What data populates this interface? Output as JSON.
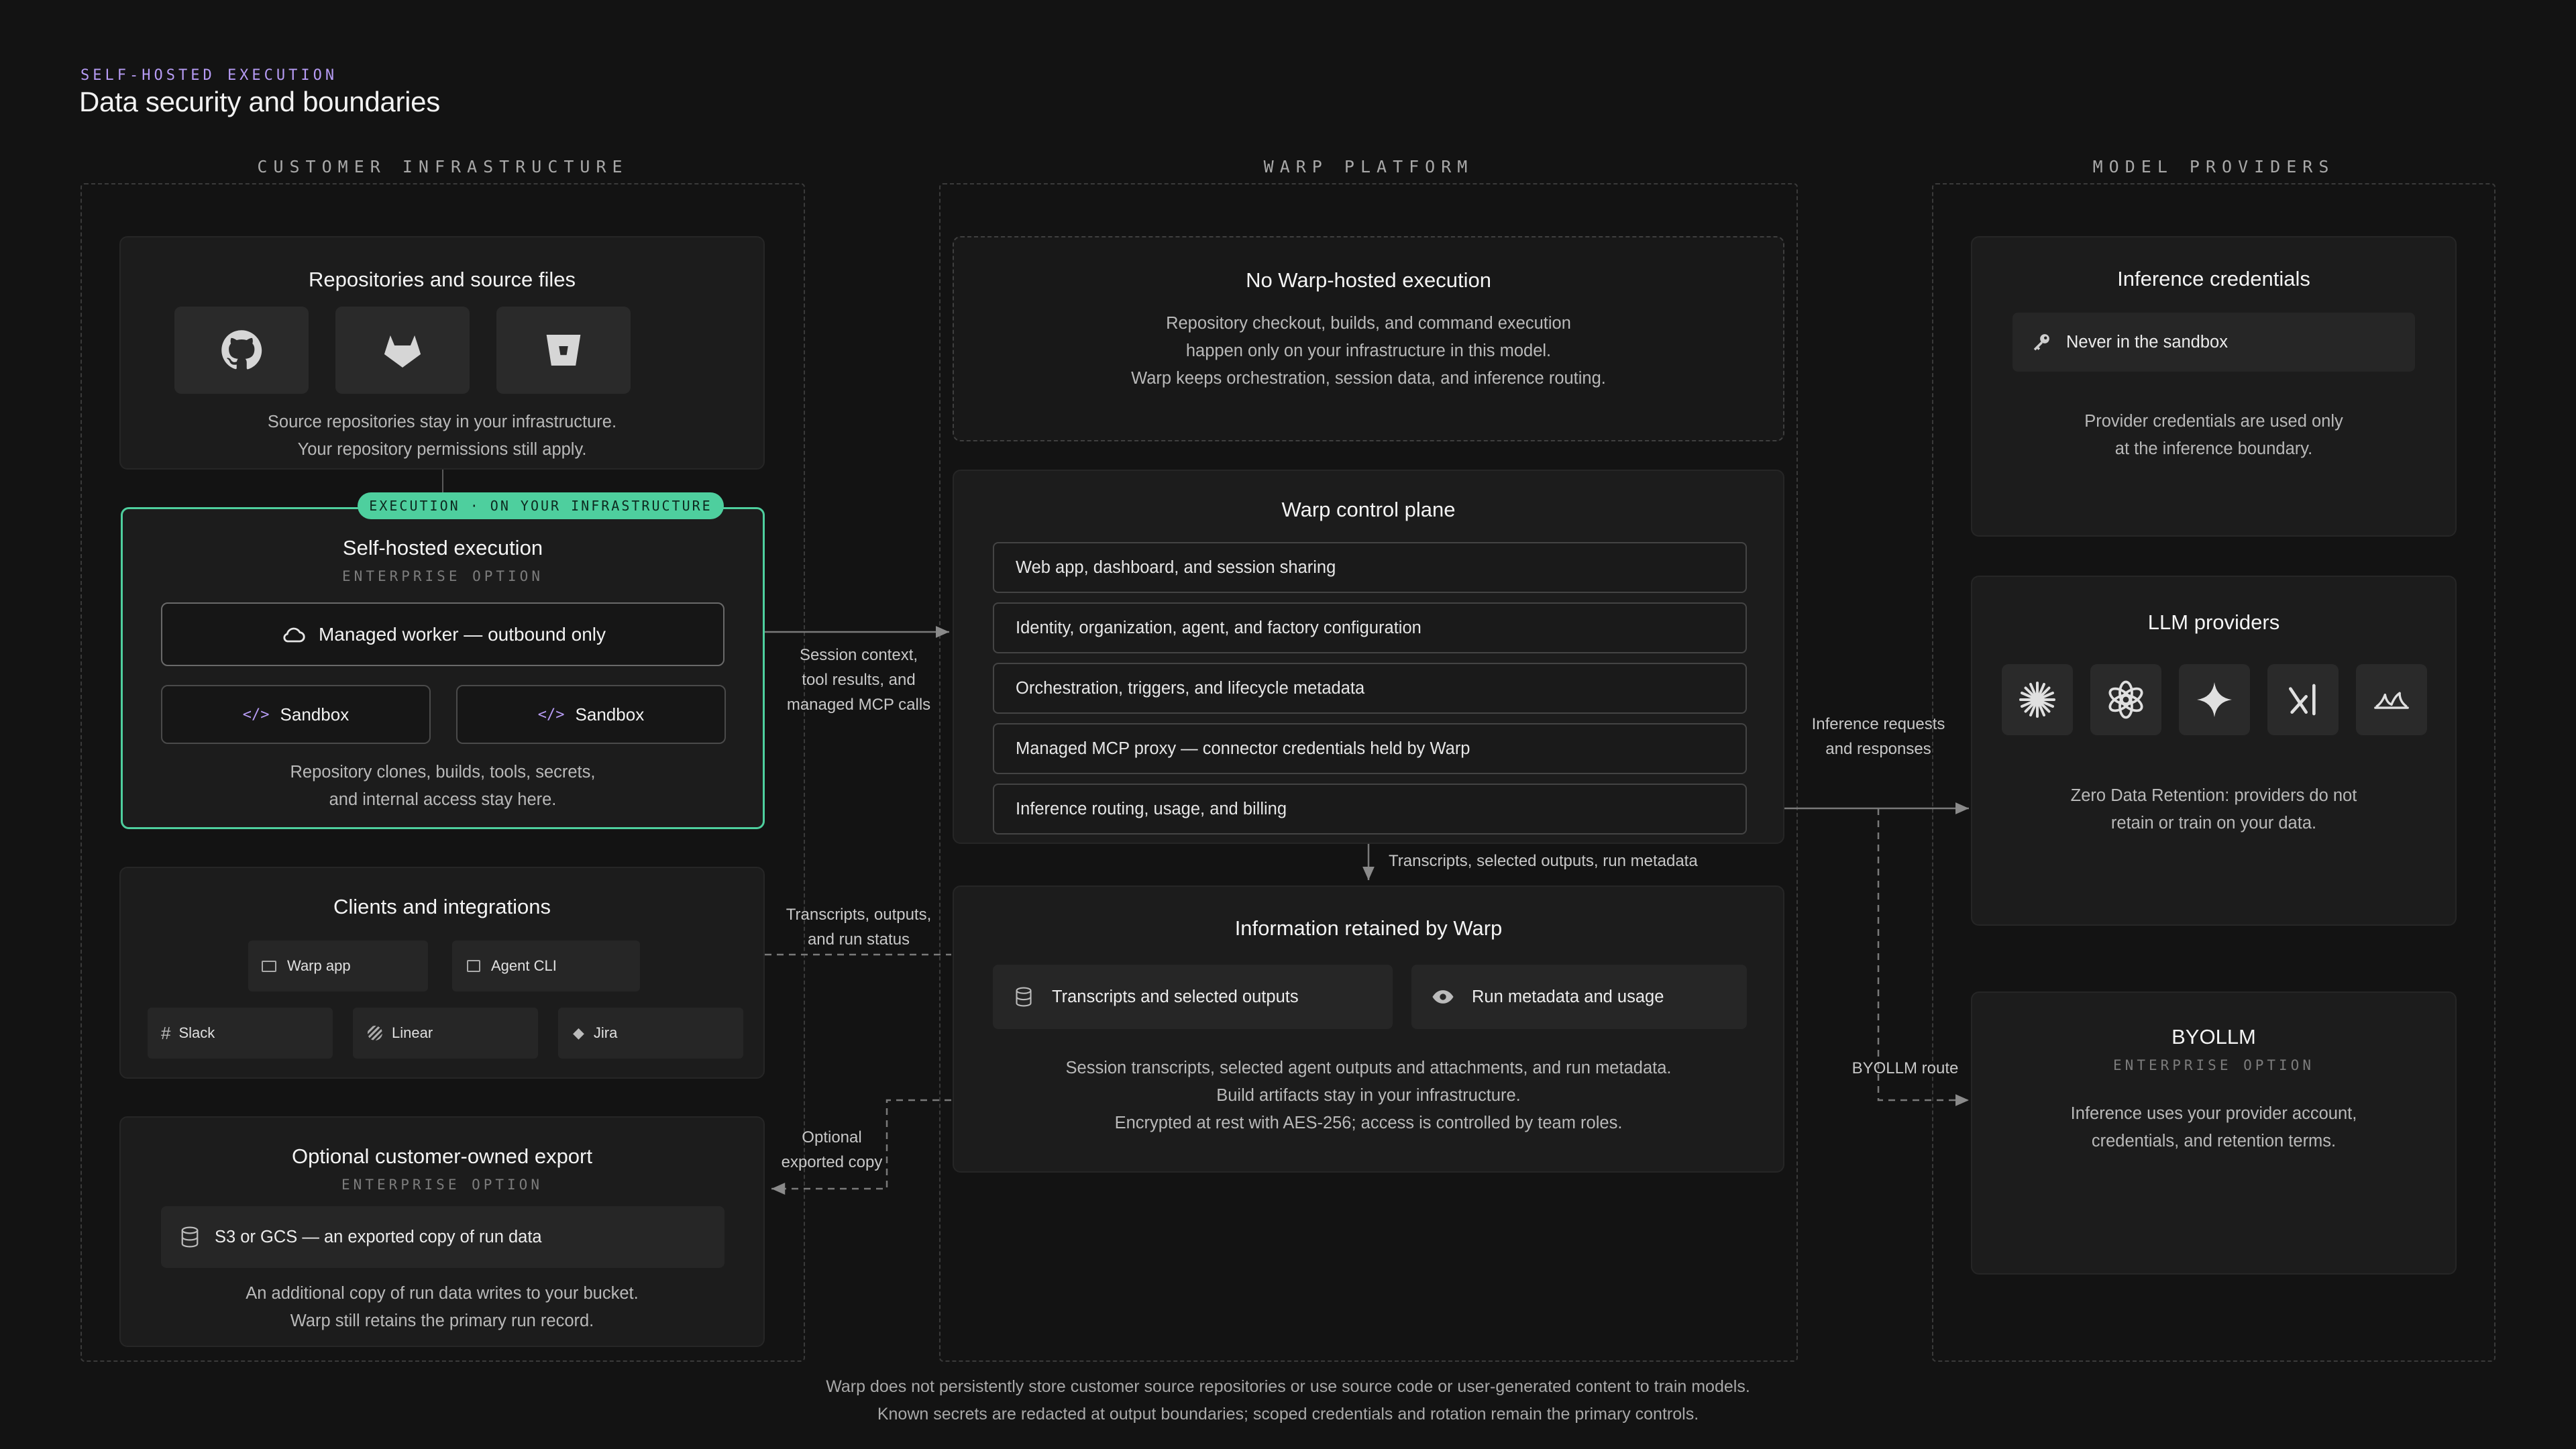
{
  "header": {
    "eyebrow": "SELF-HOSTED EXECUTION",
    "title": "Data security and boundaries"
  },
  "columns": {
    "customer": "CUSTOMER INFRASTRUCTURE",
    "warp": "WARP PLATFORM",
    "providers": "MODEL PROVIDERS"
  },
  "customer": {
    "repos": {
      "title": "Repositories and source files",
      "icons": [
        "github-icon",
        "gitlab-icon",
        "bitbucket-icon"
      ],
      "text": "Source repositories stay in your infrastructure.\nYour repository permissions still apply."
    },
    "execution": {
      "badge": "EXECUTION · ON YOUR INFRASTRUCTURE",
      "title": "Self-hosted execution",
      "subtitle": "ENTERPRISE OPTION",
      "worker": "Managed worker — outbound only",
      "sandbox_1": "Sandbox",
      "sandbox_2": "Sandbox",
      "text": "Repository clones, builds, tools, secrets,\nand internal access stay here.",
      "accent": "#4ecf9e"
    },
    "clients": {
      "title": "Clients and integrations",
      "warp_app": "Warp app",
      "agent_cli": "Agent CLI",
      "slack": "Slack",
      "linear": "Linear",
      "jira": "Jira"
    },
    "export": {
      "title": "Optional customer-owned export",
      "subtitle": "ENTERPRISE OPTION",
      "storage": "S3 or GCS — an exported copy of run data",
      "text": "An additional copy of run data writes to your bucket.\nWarp still retains the primary run record."
    }
  },
  "warp": {
    "no_hosted": {
      "title": "No Warp-hosted execution",
      "text": "Repository checkout, builds, and command execution\nhappen only on your infrastructure in this model.\nWarp keeps orchestration, session data, and inference routing."
    },
    "control_plane": {
      "title": "Warp control plane",
      "rows": [
        "Web app, dashboard, and session sharing",
        "Identity, organization, agent, and factory configuration",
        "Orchestration, triggers, and lifecycle metadata",
        "Managed MCP proxy — connector credentials held by Warp",
        "Inference routing, usage, and billing"
      ]
    },
    "retained": {
      "title": "Information retained by Warp",
      "transcripts": "Transcripts and selected outputs",
      "metadata": "Run metadata and usage",
      "text": "Session transcripts, selected agent outputs and attachments, and run metadata.\nBuild artifacts stay in your infrastructure.\nEncrypted at rest with AES-256; access is controlled by team roles."
    }
  },
  "providers": {
    "credentials": {
      "title": "Inference credentials",
      "pill": "Never in the sandbox",
      "text": "Provider credentials are used only\nat the inference boundary."
    },
    "llm": {
      "title": "LLM providers",
      "icons": [
        "anthropic-icon",
        "openai-icon",
        "gemini-icon",
        "xai-icon",
        "other-provider-icon"
      ],
      "text": "Zero Data Retention: providers do not\nretain or train on your data."
    },
    "byollm": {
      "title": "BYOLLM",
      "subtitle": "ENTERPRISE OPTION",
      "text": "Inference uses your provider account,\ncredentials, and retention terms."
    }
  },
  "connectors": {
    "session_context": "Session context,\ntool results, and\nmanaged MCP calls",
    "transcripts_outputs": "Transcripts, outputs,\nand run status",
    "optional_export": "Optional\nexported copy",
    "transcripts_metadata": "Transcripts, selected outputs, run metadata",
    "inference": "Inference requests\nand responses",
    "byollm_route": "BYOLLM route"
  },
  "footer": {
    "line1": "Warp does not persistently store customer source repositories or use source code or user-generated content to train models.",
    "line2": "Known secrets are redacted at output boundaries; scoped credentials and rotation remain the primary controls."
  }
}
